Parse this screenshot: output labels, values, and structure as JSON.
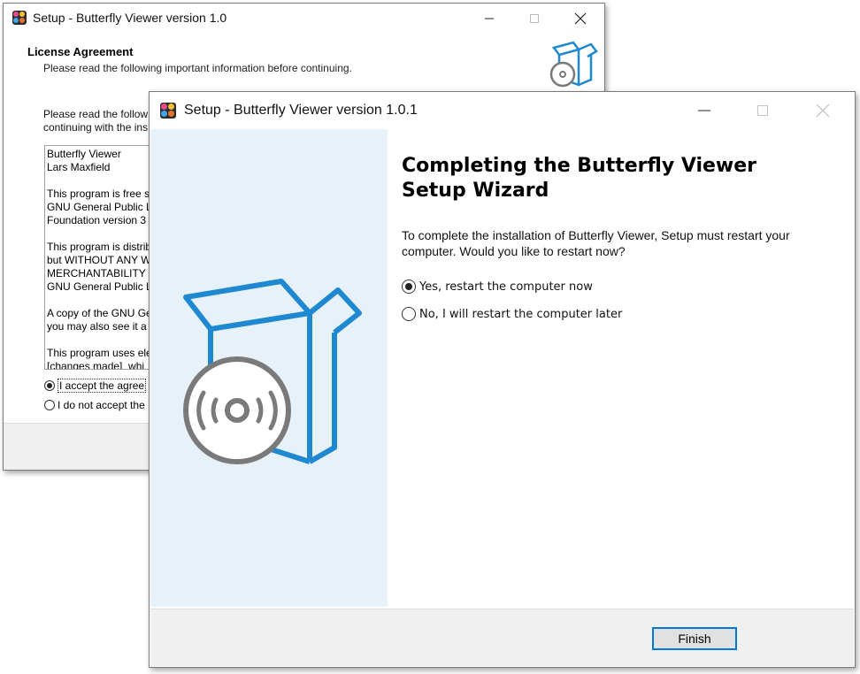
{
  "back_window": {
    "title": "Setup - Butterfly Viewer version 1.0",
    "header_title": "License Agreement",
    "header_subtitle": "Please read the following important information before continuing.",
    "intro_lines": [
      "Please read the follow",
      "continuing with the ins"
    ],
    "license_paragraphs": [
      "Butterfly Viewer\nLars Maxfield",
      "This program is free s\nGNU General Public Li\nFoundation version 3",
      "This program is distrib\nbut WITHOUT ANY W\nMERCHANTABILITY o\nGNU General Public Li",
      "A copy of the GNU Ge\nyou may also see it a",
      "This program uses ele\n[changes made]  whi"
    ],
    "accept_label": "I accept the agree",
    "decline_label": "I do not accept the",
    "accept_selected": true
  },
  "front_window": {
    "title": "Setup - Butterfly Viewer version 1.0.1",
    "wizard_title": "Completing the Butterfly Viewer Setup Wizard",
    "message": "To complete the installation of Butterfly Viewer, Setup must restart your computer. Would you like to restart now?",
    "options": [
      {
        "label": "Yes, restart the computer now",
        "selected": true
      },
      {
        "label": "No, I will restart the computer later",
        "selected": false
      }
    ],
    "finish_label": "Finish"
  },
  "colors": {
    "accent": "#0078d7",
    "box_blue": "#1e88d0",
    "disc_gray": "#7a7a7a",
    "panel_bg": "#e6f1f9"
  }
}
